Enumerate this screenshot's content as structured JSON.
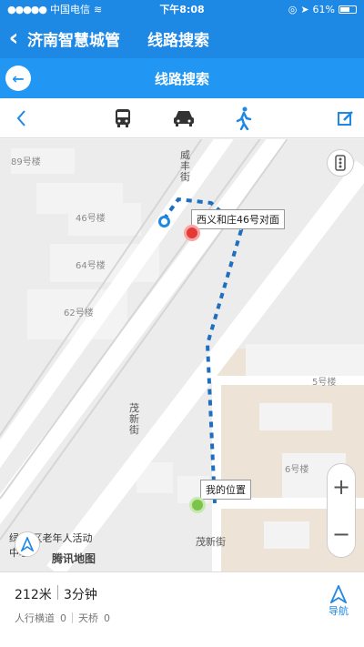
{
  "status_bar": {
    "carrier": "中国电信",
    "time": "下午8:08",
    "battery": "61%"
  },
  "header": {
    "back_label": "济南智慧城管",
    "title": "线路搜索"
  },
  "nav": {
    "title": "线路搜索"
  },
  "transport_modes": [
    "bus-icon",
    "car-icon",
    "walk-icon"
  ],
  "map": {
    "buildings": [
      "89号楼",
      "46号楼",
      "64号楼",
      "62号楼",
      "5号楼",
      "6号楼"
    ],
    "roads": [
      "威丰街",
      "茂新街"
    ],
    "destination_callout": "西义和庄46号对面",
    "my_location_callout": "我的位置",
    "poi_text": "茂新街",
    "community_text": "绿    社区老年人活动中心",
    "map_brand": "腾讯地图"
  },
  "route": {
    "distance": "212米",
    "duration": "3分钟",
    "sidewalk_label": "人行横道",
    "sidewalk_count": "0",
    "bridge_label": "天桥",
    "bridge_count": "0",
    "navigate_label": "导航"
  },
  "colors": {
    "primary": "#1e88e5",
    "route": "#1e6fc0",
    "destination": "#e53935",
    "current": "#7cc34a"
  }
}
